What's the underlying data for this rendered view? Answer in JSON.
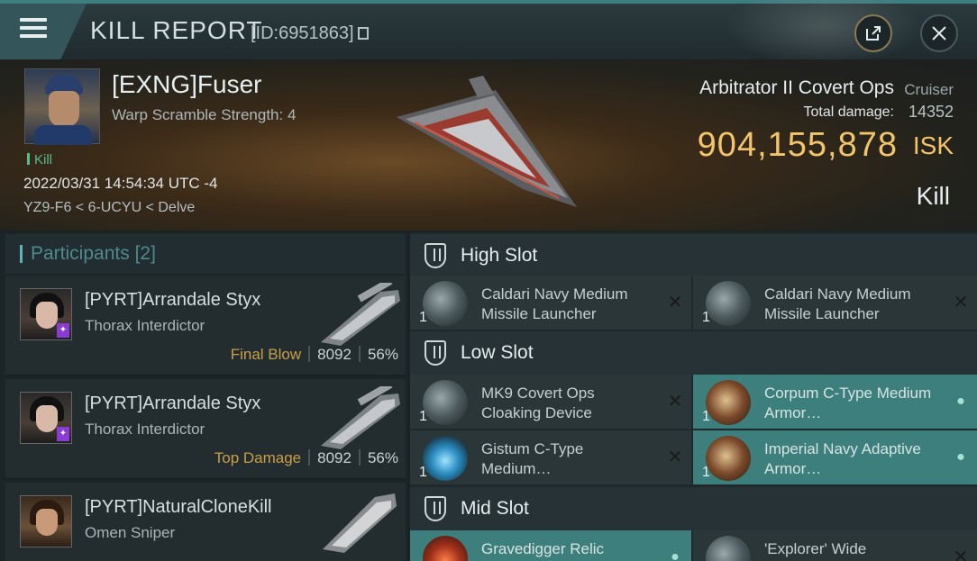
{
  "window": {
    "title": "KILL REPORT",
    "id_text": "[ID:6951863]",
    "menu_icon": "hamburger-icon",
    "external_icon": "external-link-icon",
    "close_icon": "close-icon"
  },
  "victim": {
    "name": "[EXNG]Fuser",
    "subtitle": "Warp Scramble Strength: 4",
    "tag": "Kill",
    "datetime": "2022/03/31 14:54:34 UTC -4",
    "location": "YZ9-F6 < 6-UCYU < Delve",
    "ship_name": "Arbitrator II Covert Ops",
    "ship_class": "Cruiser",
    "total_damage_label": "Total damage:",
    "total_damage": "14352",
    "isk_value": "904,155,878",
    "isk_unit": "ISK",
    "outcome": "Kill"
  },
  "participants": {
    "label": "Participants",
    "count": "[2]",
    "rows": [
      {
        "name": "[PYRT]Arrandale Styx",
        "ship": "Thorax Interdictor",
        "role": "Final Blow",
        "damage": "8092",
        "percent": "56%"
      },
      {
        "name": "[PYRT]Arrandale Styx",
        "ship": "Thorax Interdictor",
        "role": "Top Damage",
        "damage": "8092",
        "percent": "56%"
      },
      {
        "name": "[PYRT]NaturalCloneKill",
        "ship": "Omen Sniper",
        "role": "",
        "damage": "",
        "percent": ""
      }
    ]
  },
  "fittings": {
    "high_slot": {
      "label": "High Slot",
      "items": [
        {
          "qty": "1",
          "name": "Caldari Navy Medium Missile Launcher",
          "status": "destroyed"
        },
        {
          "qty": "1",
          "name": "Caldari Navy Medium Missile Launcher",
          "status": "destroyed"
        }
      ]
    },
    "low_slot": {
      "label": "Low Slot",
      "items": [
        {
          "qty": "1",
          "name": "MK9 Covert Ops Cloaking Device",
          "status": "destroyed"
        },
        {
          "qty": "1",
          "name": "Corpum C-Type Medium Armor…",
          "status": "dropped"
        },
        {
          "qty": "1",
          "name": "Gistum C-Type Medium…",
          "status": "destroyed"
        },
        {
          "qty": "1",
          "name": "Imperial Navy Adaptive Armor…",
          "status": "dropped"
        }
      ]
    },
    "mid_slot": {
      "label": "Mid Slot",
      "items": [
        {
          "qty": "",
          "name": "Gravedigger Relic",
          "status": "dropped"
        },
        {
          "qty": "",
          "name": "'Explorer' Wide",
          "status": "destroyed"
        }
      ]
    }
  },
  "colors": {
    "accent": "#3e7d80",
    "isk": "#f2c56a",
    "role": "#c89f48",
    "dropped": "#3c7f7d"
  }
}
